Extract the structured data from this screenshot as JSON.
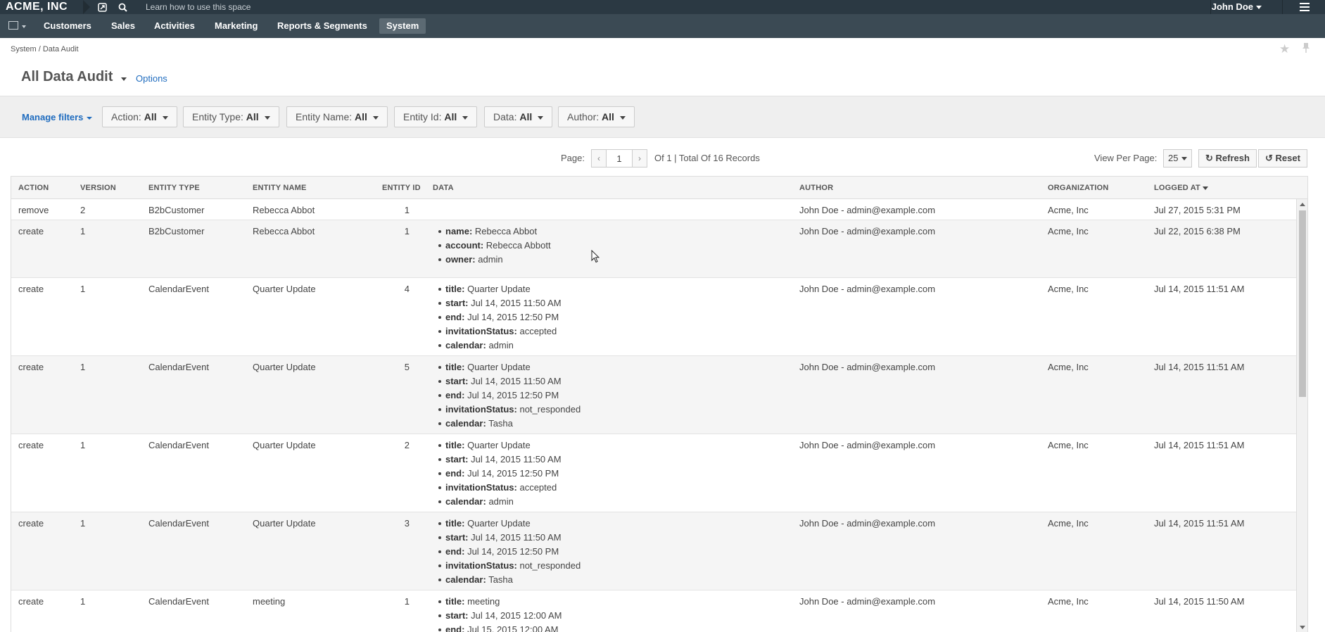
{
  "topbar": {
    "logo": "ACME, INC",
    "learn_text": "Learn how to use this space",
    "user_name": "John Doe"
  },
  "nav": {
    "items": [
      {
        "label": "Customers",
        "active": false
      },
      {
        "label": "Sales",
        "active": false
      },
      {
        "label": "Activities",
        "active": false
      },
      {
        "label": "Marketing",
        "active": false
      },
      {
        "label": "Reports & Segments",
        "active": false
      },
      {
        "label": "System",
        "active": true
      }
    ]
  },
  "breadcrumb": "System / Data Audit",
  "page": {
    "title": "All Data Audit",
    "options_label": "Options"
  },
  "filters": {
    "manage_label": "Manage filters",
    "items": [
      {
        "label": "Action:",
        "value": "All"
      },
      {
        "label": "Entity Type:",
        "value": "All"
      },
      {
        "label": "Entity Name:",
        "value": "All"
      },
      {
        "label": "Entity Id:",
        "value": "All"
      },
      {
        "label": "Data:",
        "value": "All"
      },
      {
        "label": "Author:",
        "value": "All"
      }
    ]
  },
  "pager": {
    "page_label": "Page:",
    "current_page": "1",
    "summary": "Of 1 | Total Of 16 Records",
    "per_page_label": "View Per Page:",
    "per_page_value": "25",
    "refresh_label": "Refresh",
    "reset_label": "Reset"
  },
  "grid": {
    "columns": [
      "ACTION",
      "VERSION",
      "ENTITY TYPE",
      "ENTITY NAME",
      "ENTITY ID",
      "DATA",
      "AUTHOR",
      "ORGANIZATION",
      "LOGGED AT"
    ],
    "rows": [
      {
        "action": "remove",
        "version": "2",
        "entity_type": "B2bCustomer",
        "entity_name": "Rebecca Abbot",
        "entity_id": "1",
        "data": [],
        "author": "John Doe - admin@example.com",
        "organization": "Acme, Inc",
        "logged_at": "Jul 27, 2015 5:31 PM"
      },
      {
        "action": "create",
        "version": "1",
        "entity_type": "B2bCustomer",
        "entity_name": "Rebecca Abbot",
        "entity_id": "1",
        "data": [
          {
            "key": "name:",
            "value": "Rebecca Abbot"
          },
          {
            "key": "account:",
            "value": "Rebecca Abbott"
          },
          {
            "key": "owner:",
            "value": "admin"
          }
        ],
        "author": "John Doe - admin@example.com",
        "organization": "Acme, Inc",
        "logged_at": "Jul 22, 2015 6:38 PM"
      },
      {
        "action": "create",
        "version": "1",
        "entity_type": "CalendarEvent",
        "entity_name": "Quarter Update",
        "entity_id": "4",
        "data": [
          {
            "key": "title:",
            "value": "Quarter Update"
          },
          {
            "key": "start:",
            "value": "Jul 14, 2015 11:50 AM"
          },
          {
            "key": "end:",
            "value": "Jul 14, 2015 12:50 PM"
          },
          {
            "key": "invitationStatus:",
            "value": "accepted"
          },
          {
            "key": "calendar:",
            "value": "admin"
          }
        ],
        "author": "John Doe - admin@example.com",
        "organization": "Acme, Inc",
        "logged_at": "Jul 14, 2015 11:51 AM"
      },
      {
        "action": "create",
        "version": "1",
        "entity_type": "CalendarEvent",
        "entity_name": "Quarter Update",
        "entity_id": "5",
        "data": [
          {
            "key": "title:",
            "value": "Quarter Update"
          },
          {
            "key": "start:",
            "value": "Jul 14, 2015 11:50 AM"
          },
          {
            "key": "end:",
            "value": "Jul 14, 2015 12:50 PM"
          },
          {
            "key": "invitationStatus:",
            "value": "not_responded"
          },
          {
            "key": "calendar:",
            "value": "Tasha"
          }
        ],
        "author": "John Doe - admin@example.com",
        "organization": "Acme, Inc",
        "logged_at": "Jul 14, 2015 11:51 AM"
      },
      {
        "action": "create",
        "version": "1",
        "entity_type": "CalendarEvent",
        "entity_name": "Quarter Update",
        "entity_id": "2",
        "data": [
          {
            "key": "title:",
            "value": "Quarter Update"
          },
          {
            "key": "start:",
            "value": "Jul 14, 2015 11:50 AM"
          },
          {
            "key": "end:",
            "value": "Jul 14, 2015 12:50 PM"
          },
          {
            "key": "invitationStatus:",
            "value": "accepted"
          },
          {
            "key": "calendar:",
            "value": "admin"
          }
        ],
        "author": "John Doe - admin@example.com",
        "organization": "Acme, Inc",
        "logged_at": "Jul 14, 2015 11:51 AM"
      },
      {
        "action": "create",
        "version": "1",
        "entity_type": "CalendarEvent",
        "entity_name": "Quarter Update",
        "entity_id": "3",
        "data": [
          {
            "key": "title:",
            "value": "Quarter Update"
          },
          {
            "key": "start:",
            "value": "Jul 14, 2015 11:50 AM"
          },
          {
            "key": "end:",
            "value": "Jul 14, 2015 12:50 PM"
          },
          {
            "key": "invitationStatus:",
            "value": "not_responded"
          },
          {
            "key": "calendar:",
            "value": "Tasha"
          }
        ],
        "author": "John Doe - admin@example.com",
        "organization": "Acme, Inc",
        "logged_at": "Jul 14, 2015 11:51 AM"
      },
      {
        "action": "create",
        "version": "1",
        "entity_type": "CalendarEvent",
        "entity_name": "meeting",
        "entity_id": "1",
        "data": [
          {
            "key": "title:",
            "value": "meeting"
          },
          {
            "key": "start:",
            "value": "Jul 14, 2015 12:00 AM"
          },
          {
            "key": "end:",
            "value": "Jul 15, 2015 12:00 AM"
          }
        ],
        "author": "John Doe - admin@example.com",
        "organization": "Acme, Inc",
        "logged_at": "Jul 14, 2015 11:50 AM"
      }
    ]
  }
}
